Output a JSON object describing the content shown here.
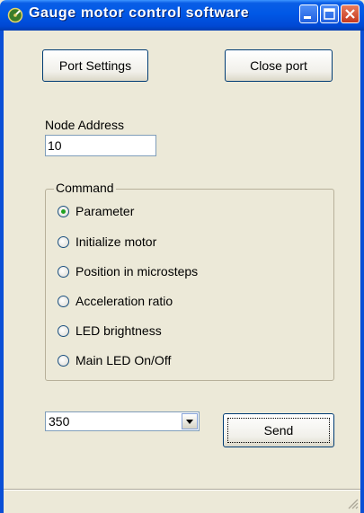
{
  "window": {
    "title": "Gauge motor control software"
  },
  "toolbar": {
    "port_settings_label": "Port Settings",
    "close_port_label": "Close port"
  },
  "node": {
    "label": "Node Address",
    "value": "10"
  },
  "command": {
    "legend": "Command",
    "selected_index": 0,
    "options": [
      "Parameter",
      "Initialize motor",
      "Position in microsteps",
      "Acceleration ratio",
      "LED brightness",
      "Main LED On/Off"
    ]
  },
  "parameter": {
    "selected_value": "350"
  },
  "actions": {
    "send_label": "Send"
  },
  "colors": {
    "titlebar": "#0058e6",
    "window_bg": "#ece9d8",
    "radio_dot": "#21a121"
  },
  "icons": {
    "app": "gauge-app-icon",
    "minimize": "minimize-icon",
    "maximize": "maximize-icon",
    "close": "close-icon",
    "dropdown": "chevron-down-icon"
  }
}
